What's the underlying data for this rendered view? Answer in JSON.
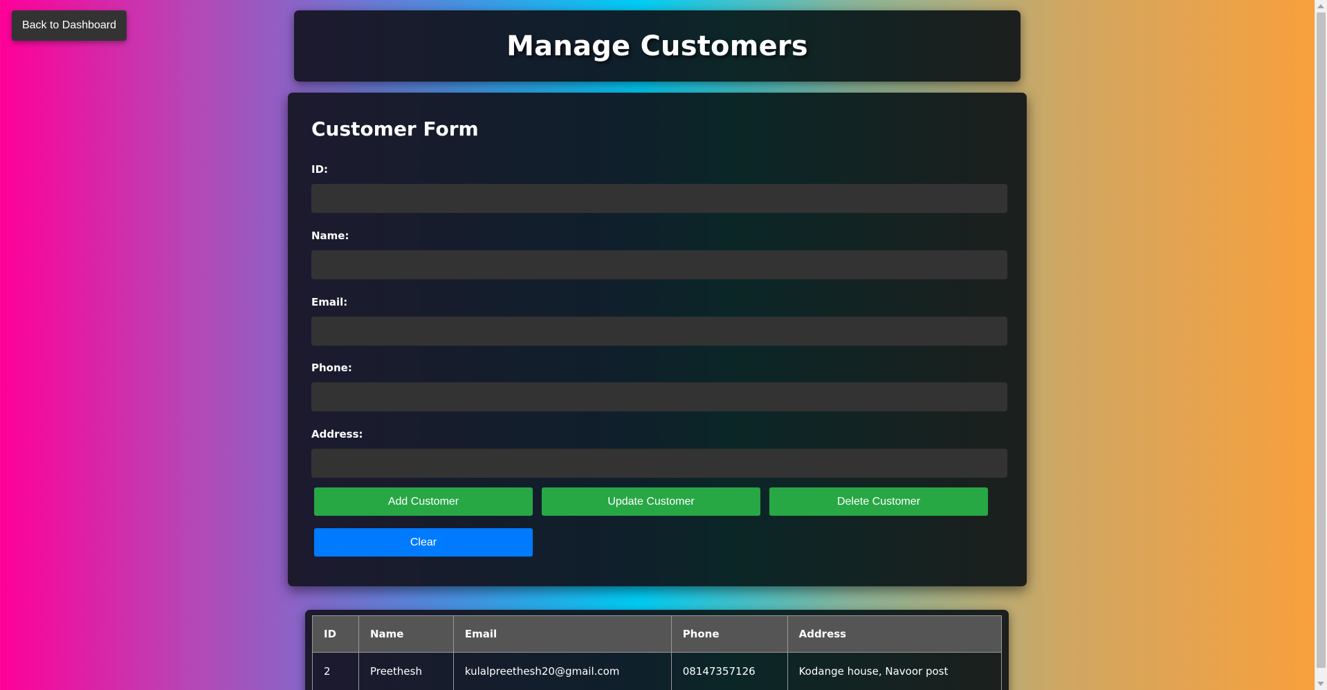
{
  "back_button": {
    "label": "Back to Dashboard"
  },
  "header": {
    "title": "Manage Customers"
  },
  "form": {
    "title": "Customer Form",
    "fields": [
      {
        "label": "ID:",
        "value": ""
      },
      {
        "label": "Name:",
        "value": ""
      },
      {
        "label": "Email:",
        "value": ""
      },
      {
        "label": "Phone:",
        "value": ""
      },
      {
        "label": "Address:",
        "value": ""
      }
    ],
    "buttons": {
      "add": "Add Customer",
      "update": "Update Customer",
      "delete": "Delete Customer",
      "clear": "Clear"
    }
  },
  "table": {
    "columns": [
      "ID",
      "Name",
      "Email",
      "Phone",
      "Address"
    ],
    "rows": [
      [
        "2",
        "Preethesh",
        "kulalpreethesh20@gmail.com",
        "08147357126",
        "Kodange house, Navoor post"
      ]
    ]
  },
  "colors": {
    "button_green": "#28a745",
    "button_blue": "#007bff",
    "input_bg": "#333333",
    "table_header_bg": "#555555"
  }
}
